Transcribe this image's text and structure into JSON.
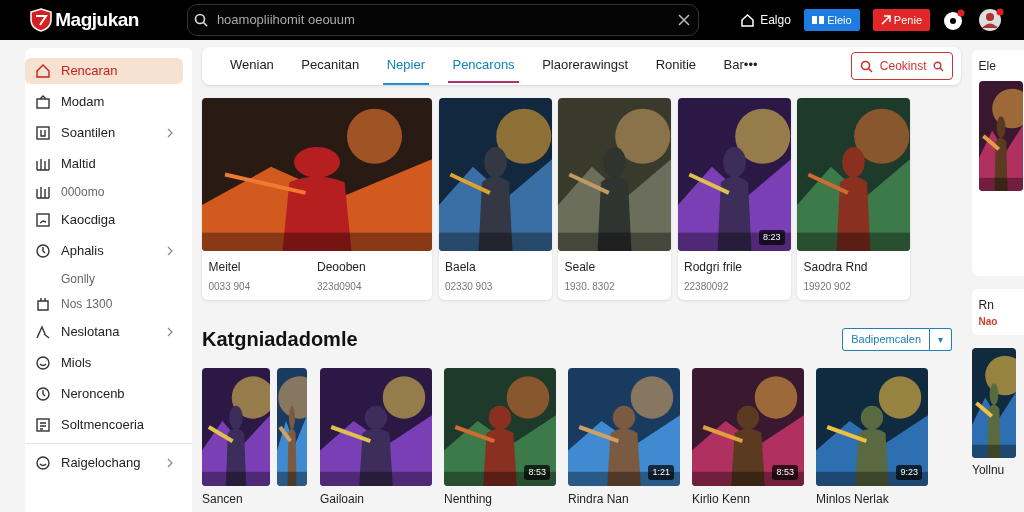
{
  "header": {
    "brand": "Magjukan",
    "search": {
      "placeholder": "hoamopliihomit oeouum"
    },
    "home_link": "Ealgo",
    "buttons": [
      {
        "label": "Eleio",
        "kind": "primary"
      },
      {
        "label": "Penie",
        "kind": "danger"
      }
    ]
  },
  "sidebar": {
    "items": [
      {
        "label": "Rencaran",
        "kind": "item",
        "selected": true,
        "chevron": false
      },
      {
        "label": "Modam",
        "kind": "item",
        "selected": false,
        "chevron": false
      },
      {
        "label": "Soantilen",
        "kind": "item",
        "selected": false,
        "chevron": true
      },
      {
        "label": "Maltid",
        "kind": "item",
        "selected": false,
        "chevron": false
      },
      {
        "label": "000omo",
        "kind": "sub",
        "selected": false,
        "chevron": false
      },
      {
        "label": "Kaocdiga",
        "kind": "item",
        "selected": false,
        "chevron": false
      },
      {
        "label": "Aphalis",
        "kind": "item",
        "selected": false,
        "chevron": true
      },
      {
        "label": "Gonlly",
        "kind": "sub",
        "selected": false,
        "chevron": false
      },
      {
        "label": "Nos 1300",
        "kind": "sub",
        "selected": false,
        "chevron": false
      },
      {
        "label": "Neslotana",
        "kind": "item",
        "selected": false,
        "chevron": true
      },
      {
        "label": "Miols",
        "kind": "item",
        "selected": false,
        "chevron": false
      },
      {
        "label": "Neroncenb",
        "kind": "item",
        "selected": false,
        "chevron": false
      },
      {
        "label": "Soltmencoeria",
        "kind": "item",
        "selected": false,
        "chevron": false
      },
      {
        "label": "Raigelochang",
        "kind": "item",
        "selected": false,
        "chevron": true
      }
    ]
  },
  "tabs": [
    {
      "label": "Wenian",
      "selected": false,
      "highlighted": false
    },
    {
      "label": "Pecanitan",
      "selected": false,
      "highlighted": false
    },
    {
      "label": "Nepier",
      "selected": true,
      "highlighted": false
    },
    {
      "label": "Pencarons",
      "selected": false,
      "highlighted": true
    },
    {
      "label": "Plaorerawingst",
      "selected": false,
      "highlighted": false
    },
    {
      "label": "Ronitie",
      "selected": false,
      "highlighted": false
    },
    {
      "label": "Bar•••",
      "selected": false,
      "highlighted": false
    }
  ],
  "tab_search": {
    "label": "Ceokinst"
  },
  "featured": [
    {
      "kind": "wide",
      "entries": [
        {
          "title": "Meitel",
          "meta": "0033 904"
        },
        {
          "title": "Deooben",
          "meta": "323d0904"
        }
      ]
    },
    {
      "kind": "single",
      "entries": [
        {
          "title": "Baela",
          "meta": "02330 903"
        }
      ]
    },
    {
      "kind": "single",
      "entries": [
        {
          "title": "Seale",
          "meta": "1930. 8302"
        }
      ]
    },
    {
      "kind": "single",
      "badge": "8:23",
      "entries": [
        {
          "title": "Rodgri frile",
          "meta": "22380092"
        }
      ]
    },
    {
      "kind": "single",
      "entries": [
        {
          "title": "Saodra Rnd",
          "meta": "19920 902"
        }
      ]
    }
  ],
  "section": {
    "title": "Katgniadadomle",
    "filter": "Badipemcalen",
    "dropdown": "▾"
  },
  "games": [
    {
      "kind": "pair",
      "title": "Sancen"
    },
    {
      "kind": "single",
      "title": "Gailoain"
    },
    {
      "kind": "single",
      "title": "Nenthing",
      "badge": "8:53"
    },
    {
      "kind": "single",
      "title": "Rindra Nan",
      "badge": "1:21"
    },
    {
      "kind": "single",
      "title": "Kirlio Kenn",
      "badge": "8:53"
    },
    {
      "kind": "single",
      "title": "Minlos Nerlak",
      "badge": "9:23"
    }
  ],
  "side_panels": [
    {
      "title": "Ele"
    },
    {
      "title": "Rn",
      "note": "Nao"
    }
  ],
  "side_tile": {
    "title": "Yollnu"
  }
}
